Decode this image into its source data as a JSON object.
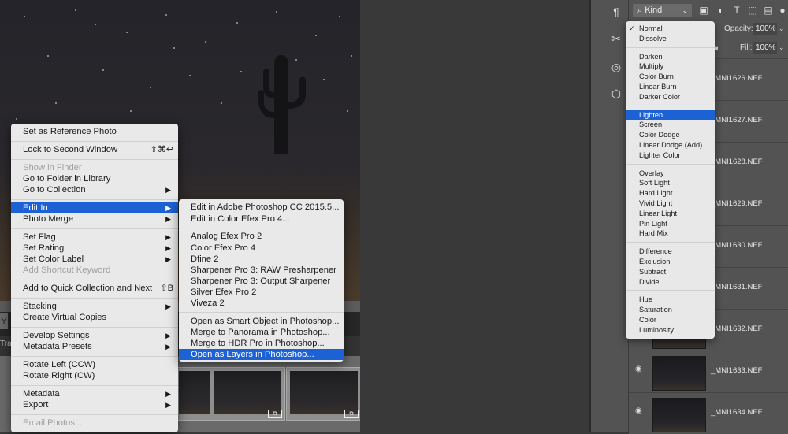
{
  "context_menu": {
    "items": [
      {
        "label": "Set as Reference Photo",
        "enabled": true
      },
      {
        "label": "Lock to Second Window",
        "shortcut": "⇧⌘↩",
        "enabled": true
      },
      {
        "label": "Show in Finder",
        "enabled": false
      },
      {
        "label": "Go to Folder in Library",
        "enabled": true
      },
      {
        "label": "Go to Collection",
        "submenu": true,
        "enabled": true
      },
      {
        "label": "Edit In",
        "submenu": true,
        "enabled": true,
        "selected": true
      },
      {
        "label": "Photo Merge",
        "submenu": true,
        "enabled": true
      },
      {
        "label": "Set Flag",
        "submenu": true,
        "enabled": true
      },
      {
        "label": "Set Rating",
        "submenu": true,
        "enabled": true
      },
      {
        "label": "Set Color Label",
        "submenu": true,
        "enabled": true
      },
      {
        "label": "Add Shortcut Keyword",
        "enabled": false
      },
      {
        "label": "Add to Quick Collection and Next",
        "shortcut": "⇧B",
        "enabled": true
      },
      {
        "label": "Stacking",
        "submenu": true,
        "enabled": true
      },
      {
        "label": "Create Virtual Copies",
        "enabled": true
      },
      {
        "label": "Develop Settings",
        "submenu": true,
        "enabled": true
      },
      {
        "label": "Metadata Presets",
        "submenu": true,
        "enabled": true
      },
      {
        "label": "Rotate Left (CCW)",
        "enabled": true
      },
      {
        "label": "Rotate Right (CW)",
        "enabled": true
      },
      {
        "label": "Metadata",
        "submenu": true,
        "enabled": true
      },
      {
        "label": "Export",
        "submenu": true,
        "enabled": true
      },
      {
        "label": "Email Photos...",
        "enabled": false
      }
    ]
  },
  "edit_in_submenu": {
    "items": [
      {
        "label": "Edit in Adobe Photoshop CC 2015.5..."
      },
      {
        "label": "Edit in Color Efex Pro 4..."
      },
      {
        "label": "Analog Efex Pro 2"
      },
      {
        "label": "Color Efex Pro 4"
      },
      {
        "label": "Dfine 2"
      },
      {
        "label": "Sharpener Pro 3: RAW Presharpener"
      },
      {
        "label": "Sharpener Pro 3: Output Sharpener"
      },
      {
        "label": "Silver Efex Pro 2"
      },
      {
        "label": "Viveza 2"
      },
      {
        "label": "Open as Smart Object in Photoshop..."
      },
      {
        "label": "Merge to Panorama in Photoshop..."
      },
      {
        "label": "Merge to HDR Pro in Photoshop..."
      },
      {
        "label": "Open as Layers in Photoshop...",
        "selected": true
      }
    ]
  },
  "lightroom": {
    "filmstrip_label": "Trai",
    "filter_letter": "Y"
  },
  "photoshop": {
    "layers_filter": {
      "kind_label": "Kind"
    },
    "opacity_label": "Opacity:",
    "opacity_value": "100%",
    "fill_label": "Fill:",
    "fill_value": "100%",
    "layers": [
      {
        "name": "_MNI1626.NEF",
        "visible": true
      },
      {
        "name": "_MNI1627.NEF",
        "visible": true
      },
      {
        "name": "_MNI1628.NEF",
        "visible": true
      },
      {
        "name": "_MNI1629.NEF",
        "visible": true
      },
      {
        "name": "_MNI1630.NEF",
        "visible": true
      },
      {
        "name": "_MNI1631.NEF",
        "visible": true
      },
      {
        "name": "_MNI1632.NEF",
        "visible": true
      },
      {
        "name": "_MNI1633.NEF",
        "visible": true
      },
      {
        "name": "_MNI1634.NEF",
        "visible": true
      }
    ],
    "blend_modes": [
      [
        "Normal",
        "Dissolve"
      ],
      [
        "Darken",
        "Multiply",
        "Color Burn",
        "Linear Burn",
        "Darker Color"
      ],
      [
        "Lighten",
        "Screen",
        "Color Dodge",
        "Linear Dodge (Add)",
        "Lighter Color"
      ],
      [
        "Overlay",
        "Soft Light",
        "Hard Light",
        "Vivid Light",
        "Linear Light",
        "Pin Light",
        "Hard Mix"
      ],
      [
        "Difference",
        "Exclusion",
        "Subtract",
        "Divide"
      ],
      [
        "Hue",
        "Saturation",
        "Color",
        "Luminosity"
      ]
    ],
    "blend_checked": "Normal",
    "blend_highlighted": "Lighten"
  },
  "colors": {
    "highlight": "#1c62d4",
    "menu_bg": "#e9e9e9",
    "ps_panel": "#535353"
  }
}
